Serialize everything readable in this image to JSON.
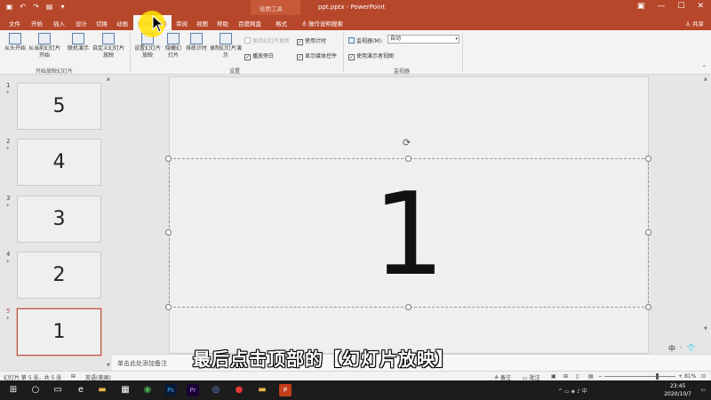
{
  "titlebar": {
    "context_tools": "绘图工具",
    "title": "ppt.pptx - PowerPoint",
    "qat": [
      "save-icon",
      "undo-icon",
      "redo-icon",
      "start-icon",
      "customize-icon"
    ]
  },
  "tabs": [
    "文件",
    "开始",
    "插入",
    "设计",
    "切换",
    "动画",
    "幻灯片放映",
    "审阅",
    "视图",
    "帮助",
    "百度网盘",
    "格式"
  ],
  "active_tab": "幻灯片放映",
  "tell_me": "操作说明搜索",
  "share": "共享",
  "ribbon": {
    "group1": {
      "label": "开始放映幻灯片",
      "buttons": [
        "从头开始",
        "从当前幻灯片开始",
        "联机演示",
        "自定义幻灯片放映"
      ]
    },
    "group2": {
      "label": "设置",
      "buttons": [
        "设置幻灯片放映",
        "隐藏幻灯片",
        "排练计时",
        "录制幻灯片演示"
      ],
      "checks": [
        {
          "label": "保持幻灯片更新",
          "checked": false,
          "disabled": true
        },
        {
          "label": "使用计时",
          "checked": true,
          "disabled": false
        },
        {
          "label": "播放旁白",
          "checked": true,
          "disabled": false
        },
        {
          "label": "显示媒体控件",
          "checked": true,
          "disabled": false
        }
      ]
    },
    "group3": {
      "label": "监视器",
      "monitor_label": "监视器(M):",
      "monitor_value": "自动",
      "presenter_view": "使用演示者视图"
    }
  },
  "slides": [
    {
      "num": "1",
      "text": "5",
      "selected": false
    },
    {
      "num": "2",
      "text": "4",
      "selected": false
    },
    {
      "num": "3",
      "text": "3",
      "selected": false
    },
    {
      "num": "4",
      "text": "2",
      "selected": false
    },
    {
      "num": "5",
      "text": "1",
      "selected": true
    }
  ],
  "star": "*",
  "canvas": {
    "text": "1"
  },
  "notes_placeholder": "单击此处添加备注",
  "subtitle": "最后点击顶部的【幻灯片放映】",
  "status": {
    "slide": "幻灯片 第 5 张，共 5 张",
    "language": "英语(美国)",
    "notes": "备注",
    "comments": "批注",
    "zoom": "81%"
  },
  "ime": {
    "lang": "中",
    "punct": "·",
    "shirt": "👕"
  },
  "taskbar": {
    "date": "2020/10/7",
    "time": "23:45",
    "apps": [
      "windows-icon",
      "search-icon",
      "task-view-icon",
      "explorer-icon",
      "chrome-icon",
      "photoshop-icon",
      "premiere-icon",
      "cinema4d-icon",
      "recorder-icon",
      "folder-icon",
      "powerpoint-icon"
    ],
    "app_labels": {
      "ps": "Ps",
      "pr": "Pr"
    }
  }
}
